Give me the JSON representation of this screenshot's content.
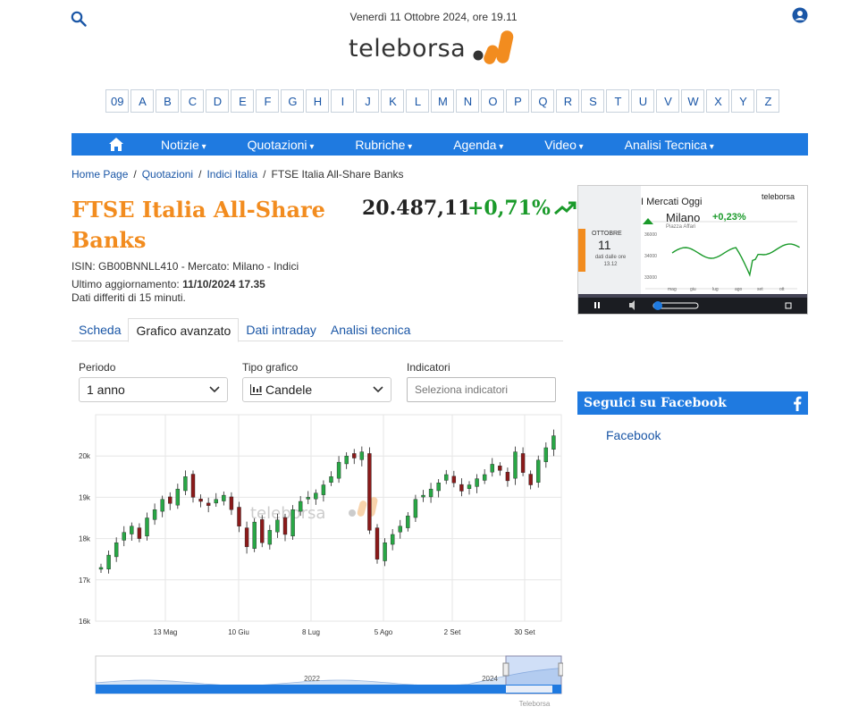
{
  "header": {
    "date": "Venerdì 11 Ottobre 2024, ore 19.11",
    "logo_text": "teleborsa"
  },
  "alphabet": [
    "09",
    "A",
    "B",
    "C",
    "D",
    "E",
    "F",
    "G",
    "H",
    "I",
    "J",
    "K",
    "L",
    "M",
    "N",
    "O",
    "P",
    "Q",
    "R",
    "S",
    "T",
    "U",
    "V",
    "W",
    "X",
    "Y",
    "Z"
  ],
  "nav": {
    "items": [
      "Notizie",
      "Quotazioni",
      "Rubriche",
      "Agenda",
      "Video",
      "Analisi Tecnica"
    ]
  },
  "breadcrumb": [
    "Home Page",
    "Quotazioni",
    "Indici Italia",
    "FTSE Italia All-Share Banks"
  ],
  "instrument": {
    "name": "FTSE Italia All-Share Banks",
    "price": "20.487,11",
    "change": "+0,71%",
    "isin_line": "ISIN: GB00BNNLL410 - Mercato: Milano - Indici",
    "updated_label": "Ultimo aggiornamento: ",
    "updated_value": "11/10/2024 17.35",
    "delay_note": "Dati differiti di 15 minuti."
  },
  "tabs": [
    "Scheda",
    "Grafico avanzato",
    "Dati intraday",
    "Analisi tecnica"
  ],
  "controls": {
    "periodo_label": "Periodo",
    "periodo_value": "1 anno",
    "tipo_label": "Tipo grafico",
    "tipo_value": "Candele",
    "indicatori_label": "Indicatori",
    "indicatori_placeholder": "Seleziona indicatori"
  },
  "video": {
    "title": "I Mercati Oggi",
    "brand": "teleborsa",
    "market": "Milano",
    "change": "+0,23%",
    "sub": "Piazza Affari",
    "month": "OTTOBRE",
    "day": "11",
    "note": "dati dalle ore 13.12",
    "y_ticks": [
      "36000",
      "34000",
      "33000"
    ],
    "x_ticks": [
      "mag",
      "giu",
      "lug",
      "ago",
      "set",
      "ott"
    ]
  },
  "facebook": {
    "title": "Seguici su Facebook",
    "link": "Facebook"
  },
  "colors": {
    "accent": "#1f7ae0",
    "brand_orange": "#f28c1f",
    "up": "#1a9a2a",
    "down": "#8b1a1a"
  },
  "chart_data": {
    "type": "candlestick",
    "title": "",
    "y_ticks": [
      "16k",
      "17k",
      "18k",
      "19k",
      "20k"
    ],
    "ylim": [
      16000,
      21000
    ],
    "x_ticks": [
      "13 Mag",
      "10 Giu",
      "8 Lug",
      "5 Ago",
      "2 Set",
      "30 Set"
    ],
    "navigator_labels": [
      "2022",
      "2024"
    ],
    "watermark": "teleborsa",
    "credit": "Teleborsa",
    "closes": [
      17300,
      17600,
      17900,
      18150,
      18300,
      18000,
      18500,
      18700,
      18950,
      18850,
      19200,
      19500,
      19000,
      18900,
      18800,
      18950,
      19050,
      18700,
      18300,
      17800,
      18400,
      17900,
      18200,
      18450,
      18100,
      18700,
      18900,
      19000,
      19100,
      19300,
      19500,
      19850,
      20000,
      19950,
      20100,
      18200,
      17500,
      17900,
      18100,
      18300,
      18550,
      18950,
      19050,
      19200,
      19350,
      19550,
      19350,
      19150,
      19300,
      19450,
      19550,
      19800,
      19650,
      19400,
      20100,
      19600,
      19300,
      19900,
      20200,
      20490
    ]
  }
}
